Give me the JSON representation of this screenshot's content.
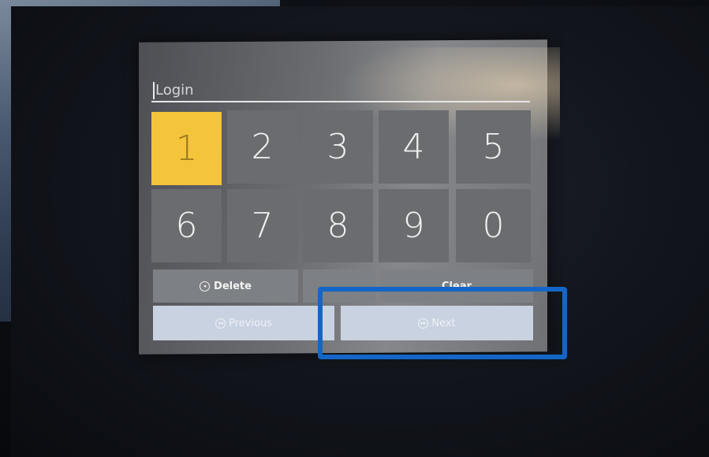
{
  "login": {
    "placeholder": "Login"
  },
  "keypad": {
    "keys": [
      "1",
      "2",
      "3",
      "4",
      "5",
      "6",
      "7",
      "8",
      "9",
      "0"
    ],
    "selected_key": "1",
    "selected_color": "#f4c43a"
  },
  "actions": {
    "delete_label": "Delete",
    "clear_label": "Clear",
    "delete_icon": "circle-back-icon"
  },
  "navigation": {
    "previous_label": "Previous",
    "next_label": "Next",
    "previous_icon": "circle-rewind-icon",
    "next_icon": "circle-forward-icon"
  },
  "annotation": {
    "highlight_color": "#1466c6"
  }
}
